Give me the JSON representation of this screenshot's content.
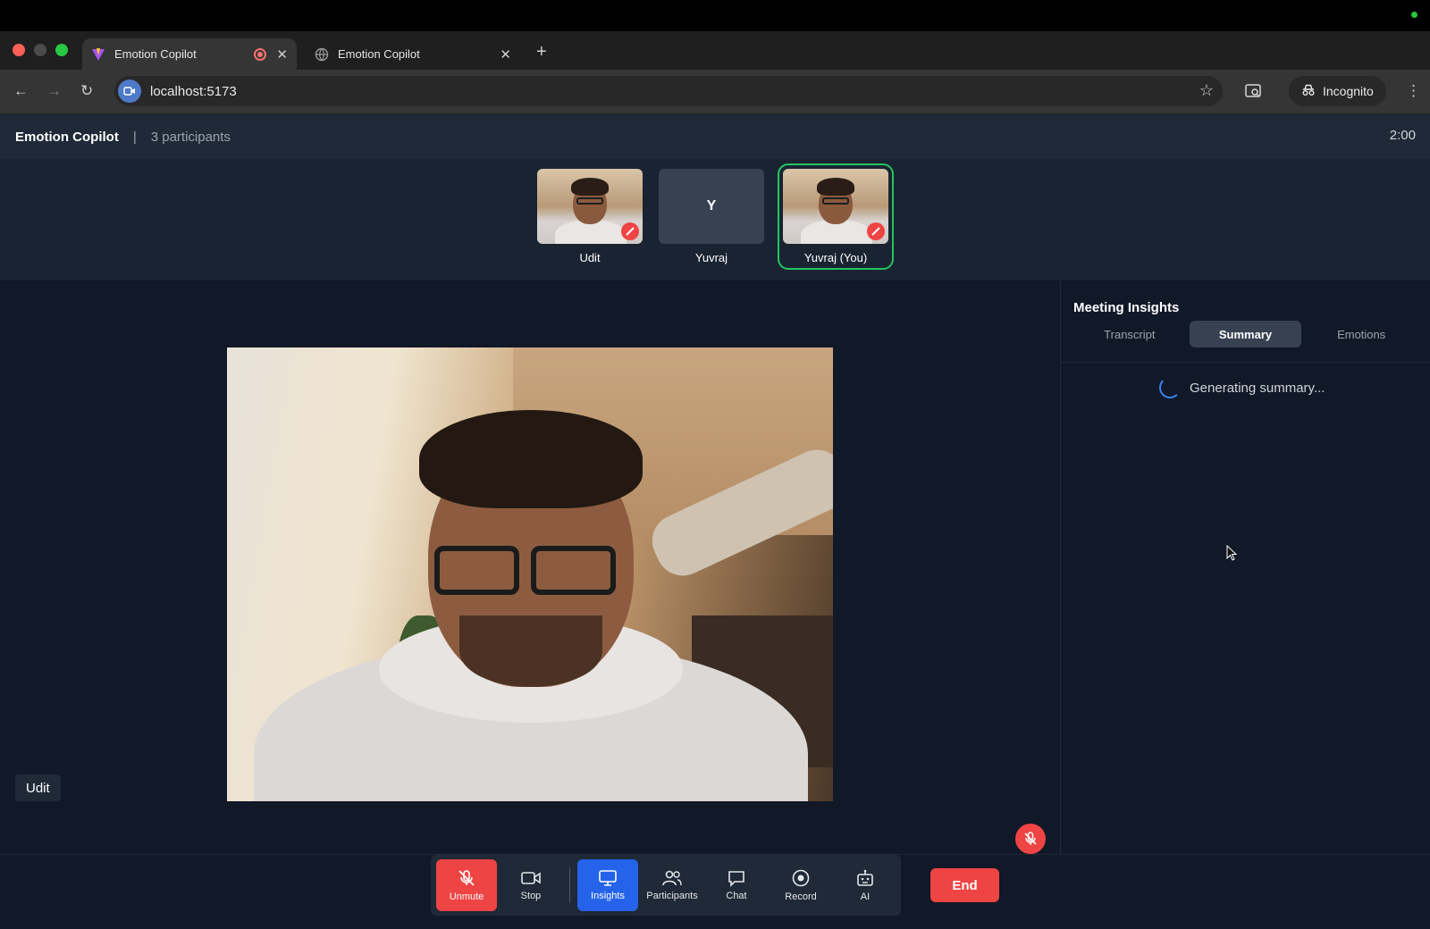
{
  "browser": {
    "tabs": [
      {
        "title": "Emotion Copilot",
        "active": true,
        "recording": true
      },
      {
        "title": "Emotion Copilot",
        "active": false
      }
    ],
    "url": "localhost:5173",
    "incognito_label": "Incognito"
  },
  "app": {
    "title": "Emotion Copilot",
    "separator": "|",
    "participant_count": "3 participants",
    "timer": "2:00"
  },
  "participants": [
    {
      "name": "Udit",
      "video": true,
      "muted": true
    },
    {
      "name": "Yuvraj",
      "initial": "Y",
      "video": false
    },
    {
      "name": "Yuvraj (You)",
      "video": true,
      "muted": true,
      "selected": true
    }
  ],
  "stage": {
    "speaker_name": "Udit"
  },
  "insights": {
    "title": "Meeting Insights",
    "tabs": [
      "Transcript",
      "Summary",
      "Emotions"
    ],
    "active_tab": "Summary",
    "status": "Generating summary..."
  },
  "controls": {
    "buttons": [
      {
        "label": "Unmute",
        "icon": "mic-off-icon",
        "style": "red"
      },
      {
        "label": "Stop",
        "icon": "video-camera-icon"
      },
      {
        "label": "Insights",
        "icon": "monitor-icon",
        "style": "blue"
      },
      {
        "label": "Participants",
        "icon": "people-icon"
      },
      {
        "label": "Chat",
        "icon": "chat-bubble-icon"
      },
      {
        "label": "Record",
        "icon": "record-icon"
      },
      {
        "label": "AI",
        "icon": "robot-icon"
      }
    ],
    "end_label": "End"
  },
  "colors": {
    "accent_blue": "#2563eb",
    "danger_red": "#ef4444",
    "selected_green": "#22c55e",
    "app_bg": "#111827"
  }
}
